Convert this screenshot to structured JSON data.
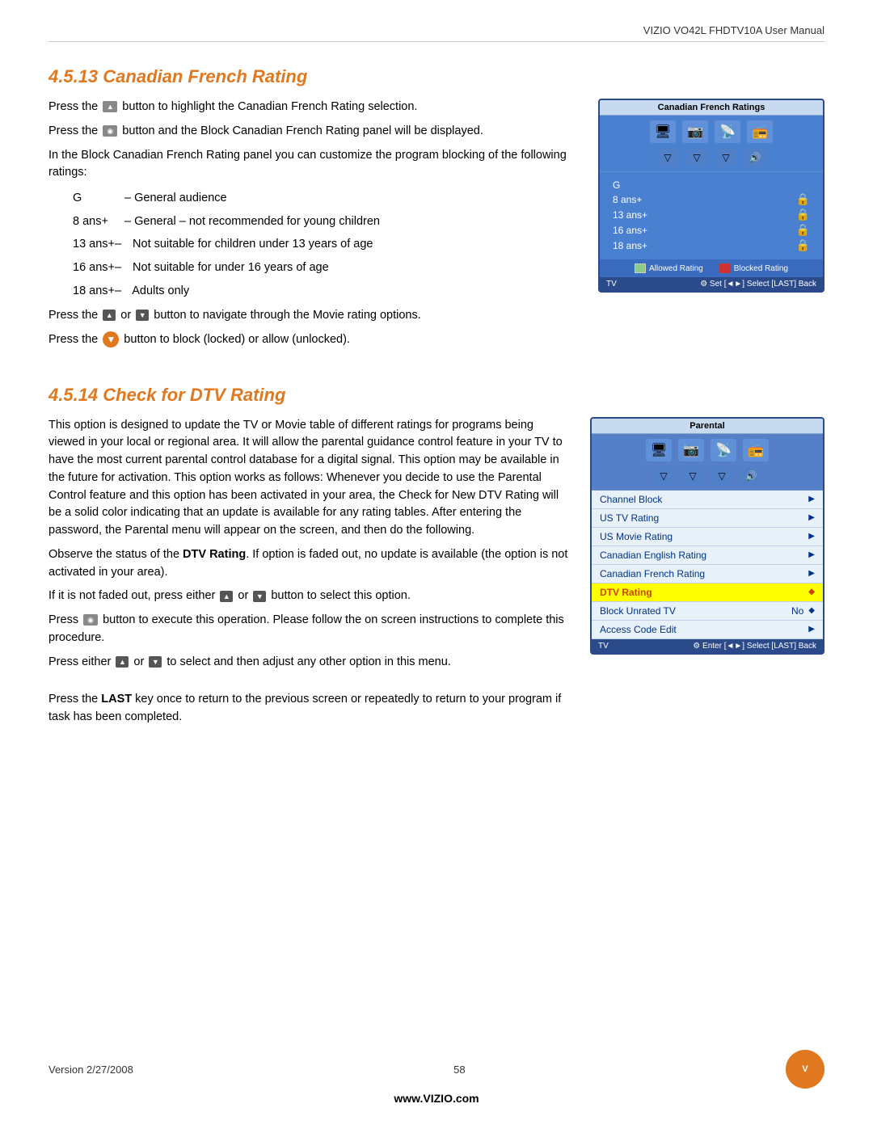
{
  "header": {
    "title": "VIZIO VO42L FHDTV10A User Manual"
  },
  "section1": {
    "title": "4.5.13 Canadian French Rating",
    "paragraphs": [
      "Press the  button to highlight the Canadian French Rating selection.",
      "Press the  button and the Block Canadian French Rating panel will be displayed.",
      "In the Block Canadian French Rating panel you can customize the program blocking of the following ratings:"
    ],
    "ratings": [
      {
        "code": "G",
        "desc": "– General audience"
      },
      {
        "code": "8 ans+",
        "desc": "– General – not recommended for young children"
      },
      {
        "code": "13 ans+–",
        "desc": "Not suitable for children under 13 years of age"
      },
      {
        "code": "16 ans+–",
        "desc": "Not suitable for under 16 years of age"
      },
      {
        "code": "18 ans+–",
        "desc": "Adults only"
      }
    ],
    "nav_text": "Press the  or  button to navigate through the Movie rating options.",
    "block_text": "Press the  button to block (locked) or allow (unlocked).",
    "panel_title": "Canadian French Ratings",
    "panel_ratings": [
      "G",
      "8 ans+",
      "13 ans+",
      "16 ans+",
      "18 ans+"
    ],
    "legend_allowed": "Allowed Rating",
    "legend_blocked": "Blocked Rating"
  },
  "section2": {
    "title": "4.5.14 Check for DTV Rating",
    "intro": "This option is designed to update the TV or Movie table of different ratings for programs being viewed in your local or regional area. It will allow the parental guidance control feature in your TV to have the most",
    "body": "current parental control database for a digital signal. This option may be available in the future for activation. This option works as follows: Whenever you decide to use the Parental Control feature and this option has been activated in your area, the Check for New DTV Rating will be a solid color indicating that an update is available for any rating tables. After entering the password, the Parental menu will appear on the screen, and then do the following.",
    "observe": "Observe the status of the DTV Rating. If option is faded out, no update is available (the option is not activated in your area).",
    "not_faded": "If it is not faded out, press either  or  button to select this option.",
    "press_execute": "Press  button to execute this operation. Please follow the on screen instructions to complete this procedure.",
    "press_either": "Press either  or  to select and then adjust any other option in this menu.",
    "press_last": "Press the LAST key once to return to the previous screen or repeatedly to return to your program if task has been completed.",
    "panel_title": "Parental",
    "menu_items": [
      {
        "label": "Channel Block",
        "value": "",
        "highlighted": false
      },
      {
        "label": "US TV Rating",
        "value": "",
        "highlighted": false
      },
      {
        "label": "US Movie Rating",
        "value": "",
        "highlighted": false
      },
      {
        "label": "Canadian English Rating",
        "value": "",
        "highlighted": false
      },
      {
        "label": "Canadian French Rating",
        "value": "",
        "highlighted": false
      },
      {
        "label": "DTV Rating",
        "value": "",
        "highlighted": true
      },
      {
        "label": "Block Unrated TV",
        "value": "No",
        "highlighted": false
      },
      {
        "label": "Access Code Edit",
        "value": "",
        "highlighted": false
      }
    ]
  },
  "footer": {
    "version": "Version 2/27/2008",
    "page": "58",
    "website": "www.VIZIO.com",
    "logo_text": "V"
  }
}
